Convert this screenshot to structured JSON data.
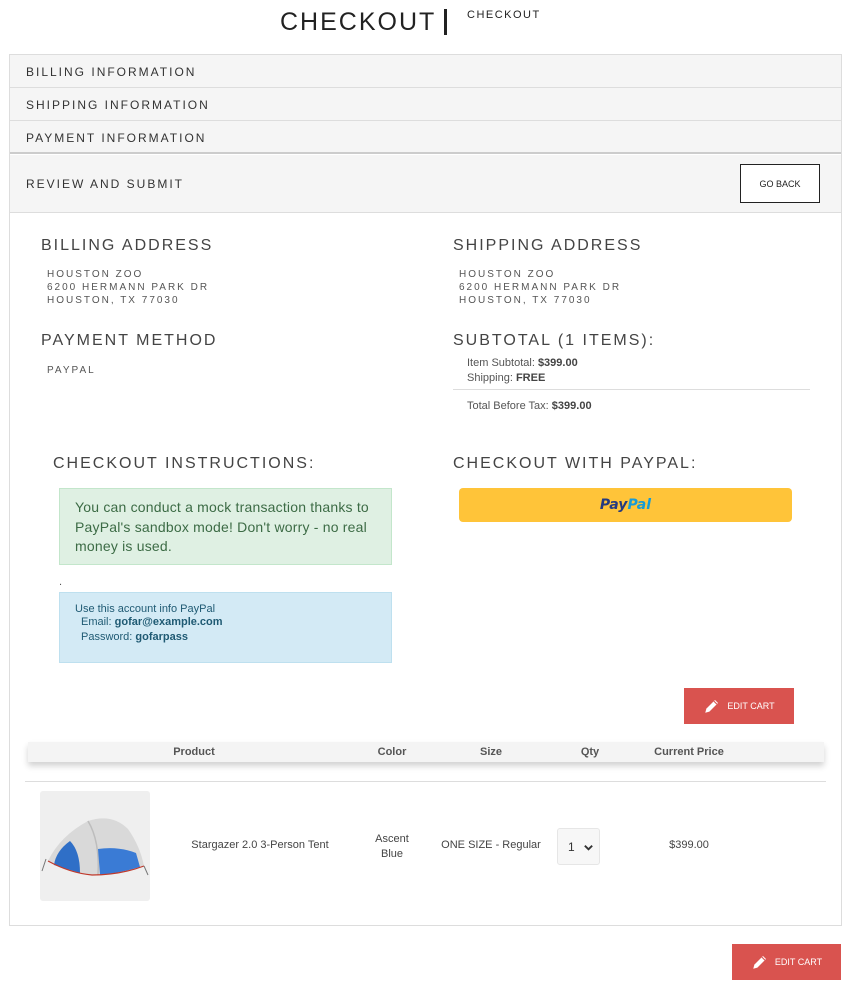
{
  "header": {
    "title": "CHECKOUT",
    "breadcrumb": "CHECKOUT"
  },
  "accordion": {
    "billing": "BILLING INFORMATION",
    "shipping": "SHIPPING INFORMATION",
    "payment": "PAYMENT INFORMATION",
    "review": "REVIEW AND SUBMIT",
    "go_back": "GO BACK"
  },
  "billing": {
    "heading": "BILLING ADDRESS",
    "lines": [
      "HOUSTON ZOO",
      "6200 HERMANN PARK DR",
      "HOUSTON, TX 77030"
    ]
  },
  "shipping": {
    "heading": "SHIPPING ADDRESS",
    "lines": [
      "HOUSTON ZOO",
      "6200 HERMANN PARK DR",
      "HOUSTON, TX 77030"
    ]
  },
  "payment_method": {
    "heading": "PAYMENT METHOD",
    "value": "PAYPAL"
  },
  "subtotal": {
    "heading": "SUBTOTAL (1 ITEMS):",
    "item_label": "Item Subtotal:",
    "item_value": "$399.00",
    "shipping_label": "Shipping:",
    "shipping_value": "FREE",
    "total_label": "Total Before Tax:",
    "total_value": "$399.00"
  },
  "instructions": {
    "heading": "CHECKOUT INSTRUCTIONS:",
    "green_text": "You can conduct a mock transaction thanks to PayPal's sandbox mode! Don't worry - no real money is used.",
    "dot": ".",
    "info_title": "Use this account info PayPal",
    "email_label": "Email:",
    "email_value": "gofar@example.com",
    "password_label": "Password:",
    "password_value": "gofarpass"
  },
  "paypal": {
    "heading": "CHECKOUT WITH PAYPAL:",
    "logo_pay": "Pay",
    "logo_pal": "Pal"
  },
  "edit_cart_label": "EDIT CART",
  "table": {
    "headers": [
      "Product",
      "Color",
      "Size",
      "Qty",
      "Current Price"
    ],
    "rows": [
      {
        "product": "Stargazer 2.0 3-Person Tent",
        "color_line1": "Ascent",
        "color_line2": "Blue",
        "size": "ONE SIZE - Regular",
        "qty": "1",
        "price": "$399.00"
      }
    ]
  },
  "colors": {
    "accent_red": "#d9534f",
    "paypal_yellow": "#ffc439",
    "success_bg": "#dff0e3",
    "info_bg": "#d3eaf5"
  }
}
